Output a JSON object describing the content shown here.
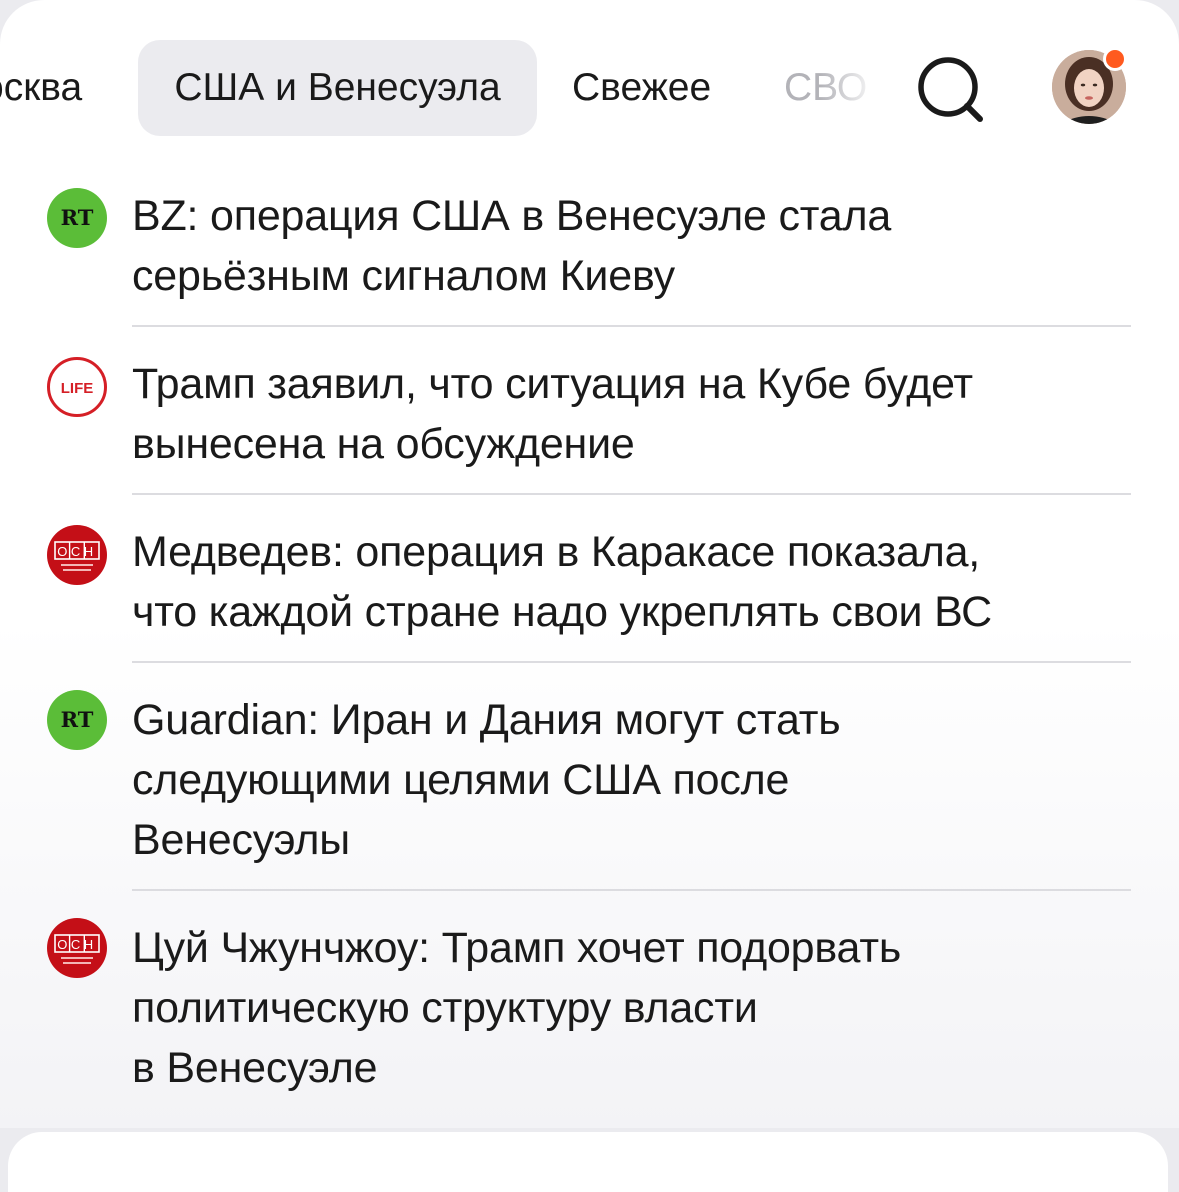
{
  "tabs": [
    {
      "label": "Москва",
      "label_visible": "осква",
      "active": false
    },
    {
      "label": "США и Венесуэла",
      "active": true
    },
    {
      "label": "Свежее",
      "active": false
    },
    {
      "label": "СВО",
      "active": false
    }
  ],
  "header": {
    "search_icon": "search-icon",
    "avatar_icon": "user-avatar",
    "notification": "notification-dot"
  },
  "news": [
    {
      "source": "RT",
      "logo_text": "RT",
      "lines": [
        "BZ: операция США в Венесуэле стала",
        "серьёзным сигналом Киеву"
      ]
    },
    {
      "source": "LIFE",
      "logo_text": "LIFE",
      "lines": [
        "Трамп заявил, что ситуация на Кубе будет",
        "вынесена на обсуждение"
      ]
    },
    {
      "source": "ОСН",
      "logo_text": "ОСН",
      "lines": [
        "Медведев: операция в Каракасе показала,",
        "что каждой стране надо укреплять свои ВС"
      ]
    },
    {
      "source": "RT",
      "logo_text": "RT",
      "lines": [
        "Guardian: Иран и Дания могут стать",
        "следующими целями США после",
        "Венесуэлы"
      ]
    },
    {
      "source": "ОСН",
      "logo_text": "ОСН",
      "lines": [
        "Цуй Чжунчжоу: Трамп хочет подорвать",
        "политическую структуру власти",
        "в Венесуэле"
      ]
    }
  ],
  "colors": {
    "rt_green": "#5bbd38",
    "life_red": "#d51f26",
    "osn_red": "#c40f17",
    "notification_orange": "#ff5a1f",
    "active_tab_bg": "#ebebef"
  }
}
